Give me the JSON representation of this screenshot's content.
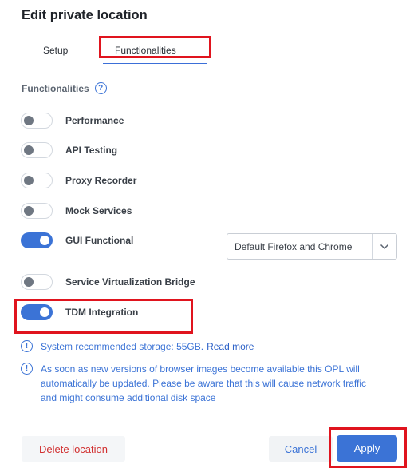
{
  "dialog": {
    "title": "Edit private location"
  },
  "tabs": [
    {
      "label": "Setup"
    },
    {
      "label": "Functionalities",
      "active": true
    }
  ],
  "section": {
    "label": "Functionalities",
    "help_icon": "question-circle-icon"
  },
  "functionalities": [
    {
      "label": "Performance",
      "enabled": false
    },
    {
      "label": "API Testing",
      "enabled": false
    },
    {
      "label": "Proxy Recorder",
      "enabled": false
    },
    {
      "label": "Mock Services",
      "enabled": false
    },
    {
      "label": "GUI Functional",
      "enabled": true
    },
    {
      "label": "Service Virtualization Bridge",
      "enabled": false
    },
    {
      "label": "TDM Integration",
      "enabled": true
    }
  ],
  "browser_select": {
    "value": "Default Firefox and Chrome",
    "icon": "chevron-down-icon"
  },
  "info": {
    "storage_text": "System recommended storage: 55GB.",
    "storage_link": "Read more",
    "update_line1": "As soon as new versions of browser images become available this OPL will",
    "update_line2": "automatically be updated. Please be aware that this will cause network traffic",
    "update_line3": "and might consume additional disk space",
    "icon": "info-circle-icon"
  },
  "footer": {
    "delete_label": "Delete location",
    "cancel_label": "Cancel",
    "apply_label": "Apply"
  },
  "colors": {
    "accent": "#3b73d6",
    "danger": "#d12f2f",
    "highlight": "#e0141e"
  }
}
